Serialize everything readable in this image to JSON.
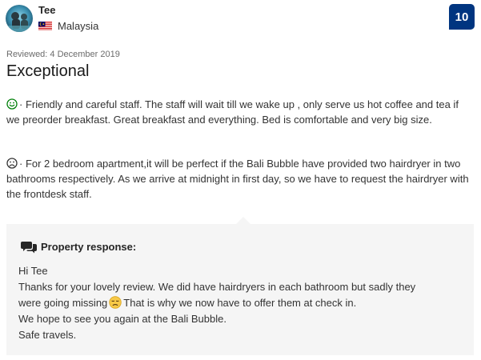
{
  "reviewer": {
    "name": "Tee",
    "country": "Malaysia",
    "avatar_icon": "avatar-photo",
    "flag_icon": "malaysia-flag-icon"
  },
  "score": "10",
  "reviewed_date": "Reviewed: 4 December 2019",
  "title": "Exceptional",
  "positive": {
    "icon": "smile-icon",
    "text": "· Friendly and careful staff. The staff will wait till we wake up , only serve us hot coffee and tea if we preorder breakfast. Great breakfast and everything. Bed is comfortable and very big size."
  },
  "negative": {
    "icon": "frown-icon",
    "text": "· For 2 bedroom apartment,it will be perfect if the Bali Bubble have provided two hairdryer in two bathrooms respectively. As we arrive at midnight in first day, so we have to request the hairdryer with the frontdesk staff."
  },
  "response": {
    "icon": "chat-bubbles-icon",
    "title": "Property response:",
    "greeting": "Hi Tee",
    "line1": "Thanks for your lovely review. We did have hairdryers in each bathroom but sadly they",
    "line2a": "were going missing",
    "line2b": "That is why we now have to offer them at check in.",
    "line3": "We hope to see you again at the Bali Bubble.",
    "line4": "Safe travels."
  },
  "colors": {
    "score_badge": "#003580",
    "positive_icon": "#008009",
    "response_bg": "#f5f5f5"
  }
}
